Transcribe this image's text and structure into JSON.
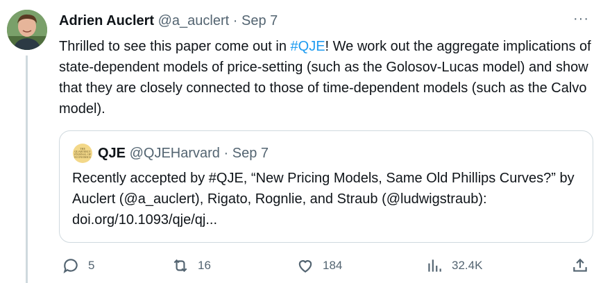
{
  "tweet": {
    "author_name": "Adrien Auclert",
    "author_handle": "@a_auclert",
    "separator": "·",
    "date": "Sep 7",
    "more_label": "···",
    "text_before": "Thrilled to see this paper come out in ",
    "hashtag": "#QJE",
    "text_after": "! We work out the aggregate implications of state-dependent models of price-setting (such as the Golosov-Lucas model) and show that they are closely connected to those of time-dependent models (such as the Calvo model)."
  },
  "quote": {
    "logo_text": "THE QUARTERLY JOURNAL OF ECONOMICS",
    "author_name": "QJE",
    "author_handle": "@QJEHarvard",
    "separator": "·",
    "date": "Sep 7",
    "text": "Recently accepted by #QJE, “New Pricing Models, Same Old Phillips Curves?” by Auclert (@a_auclert), Rigato, Rognlie, and Straub (@ludwigstraub): doi.org/10.1093/qje/qj..."
  },
  "actions": {
    "replies": "5",
    "retweets": "16",
    "likes": "184",
    "views": "32.4K"
  },
  "colors": {
    "accent": "#1d9bf0",
    "muted": "#536471",
    "border": "#cfd9de"
  }
}
